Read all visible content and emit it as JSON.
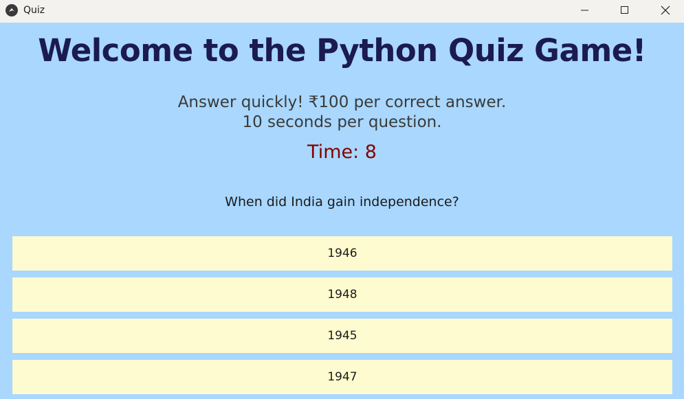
{
  "window": {
    "title": "Quiz",
    "app_icon": "kivy-icon",
    "controls": {
      "minimize": "minimize-icon",
      "maximize": "maximize-icon",
      "close": "close-icon"
    }
  },
  "quiz": {
    "heading": "Welcome to the Python Quiz Game!",
    "instructions_line1": "Answer quickly! ₹100 per correct answer.",
    "instructions_line2": "10 seconds per question.",
    "timer_text": "Time: 8",
    "question": "When did India gain independence?",
    "options": [
      "1946",
      "1948",
      "1945",
      "1947"
    ]
  },
  "colors": {
    "background": "#a9d7fe",
    "heading": "#1b1a52",
    "timer": "#850000",
    "option_background": "#fefbd0"
  }
}
